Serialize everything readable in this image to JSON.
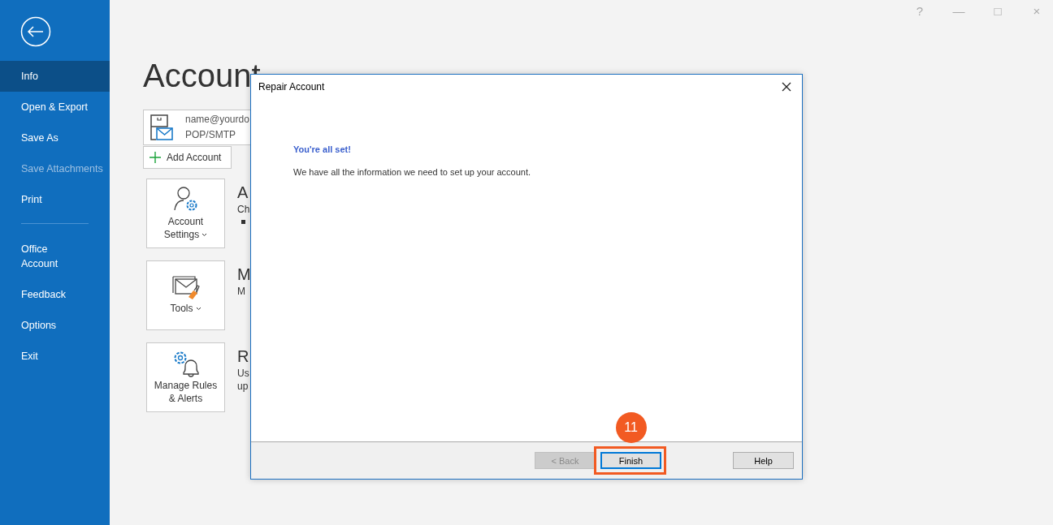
{
  "window_controls": [
    "?",
    "—",
    "□",
    "×"
  ],
  "sidebar": {
    "groups": [
      [
        {
          "label": "Info",
          "selected": true,
          "disabled": false
        },
        {
          "label": "Open & Export",
          "selected": false,
          "disabled": false
        },
        {
          "label": "Save As",
          "selected": false,
          "disabled": false
        },
        {
          "label": "Save Attachments",
          "selected": false,
          "disabled": true
        },
        {
          "label": "Print",
          "selected": false,
          "disabled": false
        }
      ],
      [
        {
          "label": "Office Account",
          "selected": false,
          "disabled": false
        },
        {
          "label": "Feedback",
          "selected": false,
          "disabled": false
        },
        {
          "label": "Options",
          "selected": false,
          "disabled": false
        },
        {
          "label": "Exit",
          "selected": false,
          "disabled": false
        }
      ]
    ]
  },
  "page_title": "Account",
  "account": {
    "email": "name@yourdo",
    "type": "POP/SMTP"
  },
  "add_account": "Add Account",
  "sections": [
    {
      "kind": "settings",
      "card_label": "Account Settings",
      "dropdown": true,
      "heading": "A",
      "lines": [
        "Ch"
      ],
      "bullet": true
    },
    {
      "kind": "tools",
      "card_label": "Tools",
      "dropdown": true,
      "heading": "M",
      "lines": [
        "M"
      ],
      "bullet": false
    },
    {
      "kind": "rules",
      "card_label": "Manage Rules & Alerts",
      "dropdown": false,
      "heading": "R",
      "lines": [
        "Us",
        "up"
      ],
      "bullet": false
    }
  ],
  "dialog": {
    "title": "Repair Account",
    "heading": "You're all set!",
    "message": "We have all the information we need to set up your account.",
    "buttons": [
      {
        "label": "< Back",
        "disabled": true,
        "default": false
      },
      {
        "label": "Finish",
        "disabled": false,
        "default": true,
        "callout": "11"
      },
      {
        "label": "Help",
        "disabled": false,
        "default": false
      }
    ]
  }
}
